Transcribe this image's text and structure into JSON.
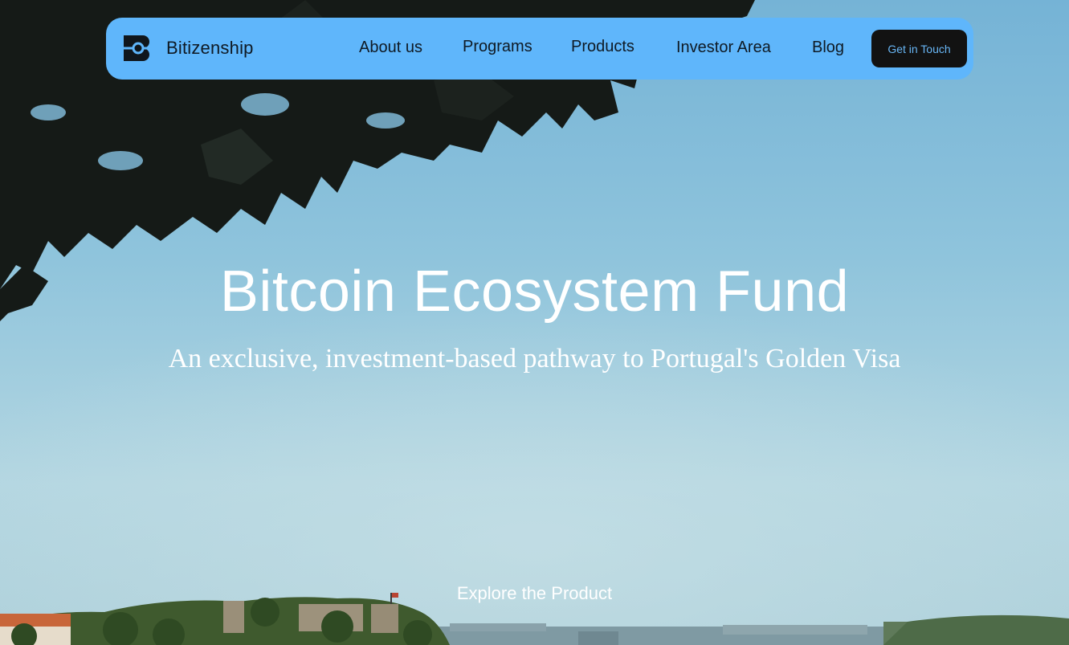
{
  "brand": {
    "name": "Bitizenship",
    "logo_icon": "bitizenship-b-logo-icon"
  },
  "nav": {
    "items": [
      {
        "label": "About us"
      },
      {
        "label": "Programs"
      },
      {
        "label": "Products"
      },
      {
        "label": "Investor Area"
      },
      {
        "label": "Blog"
      }
    ],
    "cta_label": "Get in Touch"
  },
  "hero": {
    "title": "Bitcoin Ecosystem Fund",
    "subtitle": "An exclusive, investment-based pathway to Portugal's Golden Visa",
    "explore_label": "Explore the Product"
  },
  "colors": {
    "navbar_bg": "#5fb6fb",
    "cta_bg": "#121212",
    "cta_text": "#68b6f5",
    "text_dark": "#0f1a24",
    "hero_text": "#ffffff"
  }
}
